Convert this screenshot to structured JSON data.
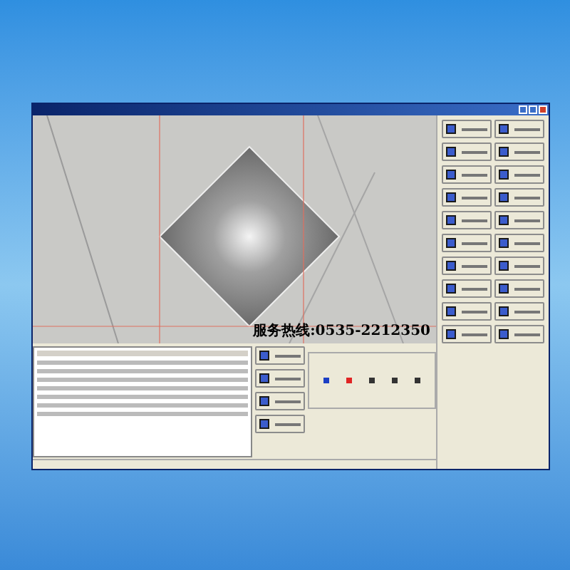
{
  "image_caption": "服务热线:0535-2212350",
  "status_dots": [
    {
      "color": "#1c3fc4"
    },
    {
      "color": "#e02424"
    },
    {
      "color": "#333333"
    },
    {
      "color": "#333333"
    },
    {
      "color": "#333333"
    }
  ]
}
